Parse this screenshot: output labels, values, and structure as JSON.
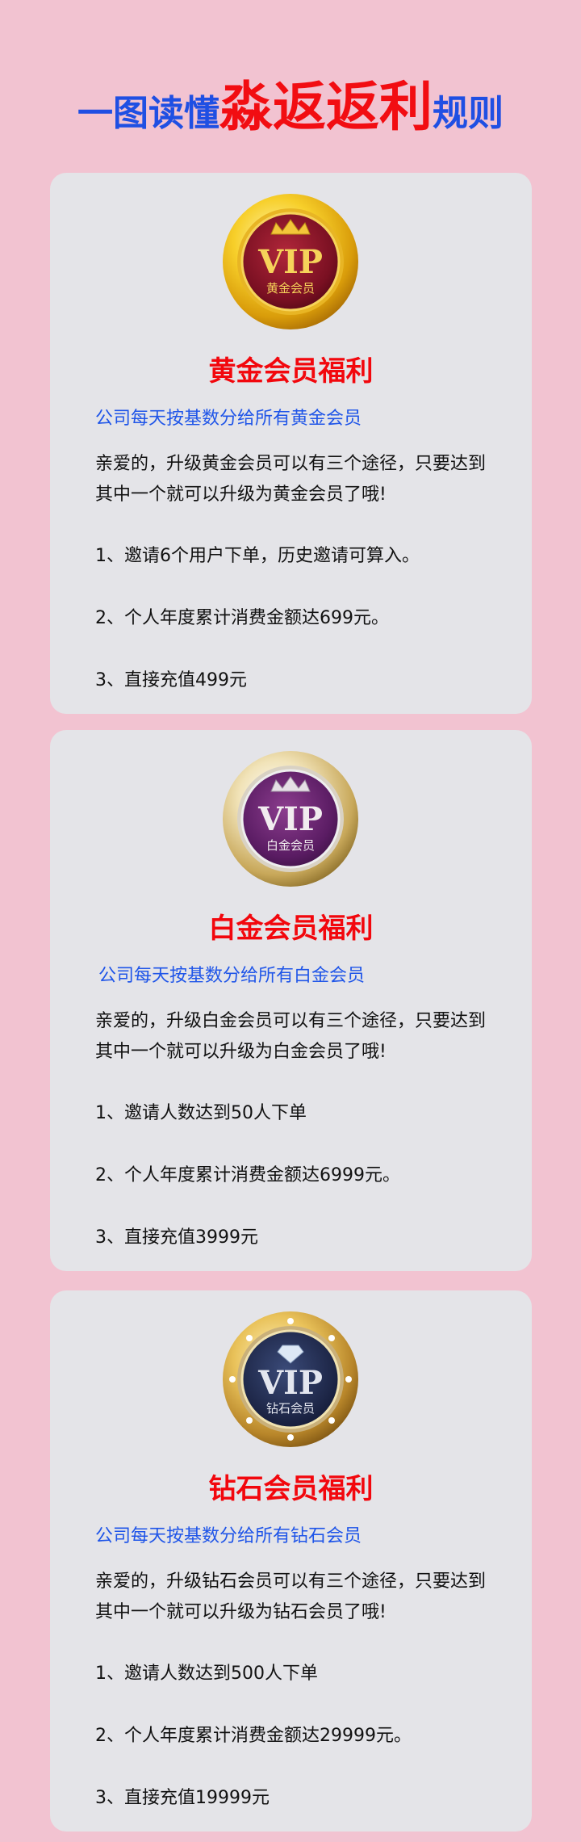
{
  "header": {
    "title_part1": "一图读懂",
    "title_part2": "淼返返利",
    "title_part3": "规则"
  },
  "colors": {
    "background": "#f2c3d1",
    "card": "#e4e4e8",
    "title_blue": "#1f4fe3",
    "title_red": "#f20d12",
    "subtitle_blue": "#1f55e8"
  },
  "cards": [
    {
      "badge": {
        "icon": "vip-gold-badge-icon",
        "vip": "VIP",
        "label": "黄金会员"
      },
      "title": "黄金会员福利",
      "subtitle": "公司每天按基数分给所有黄金会员",
      "intro_line1": "亲爱的，升级黄金会员可以有三个途径，只要达到",
      "intro_line2": "其中一个就可以升级为黄金会员了哦!",
      "items": [
        "1、邀请6个用户下单，历史邀请可算入。",
        "2、个人年度累计消费金额达699元。",
        "3、直接充值499元"
      ]
    },
    {
      "badge": {
        "icon": "vip-platinum-badge-icon",
        "vip": "VIP",
        "label": "白金会员"
      },
      "title": "白金会员福利",
      "subtitle": "公司每天按基数分给所有白金会员",
      "intro_line1": "亲爱的，升级白金会员可以有三个途径，只要达到",
      "intro_line2": "其中一个就可以升级为白金会员了哦!",
      "items": [
        "1、邀请人数达到50人下单",
        "2、个人年度累计消费金额达6999元。",
        "3、直接充值3999元"
      ]
    },
    {
      "badge": {
        "icon": "vip-diamond-badge-icon",
        "vip": "VIP",
        "label": "钻石会员"
      },
      "title": "钻石会员福利",
      "subtitle": "公司每天按基数分给所有钻石会员",
      "intro_line1": "亲爱的，升级钻石会员可以有三个途径，只要达到",
      "intro_line2": "其中一个就可以升级为钻石会员了哦!",
      "items": [
        "1、邀请人数达到500人下单",
        "2、个人年度累计消费金额达29999元。",
        "3、直接充值19999元"
      ]
    }
  ]
}
